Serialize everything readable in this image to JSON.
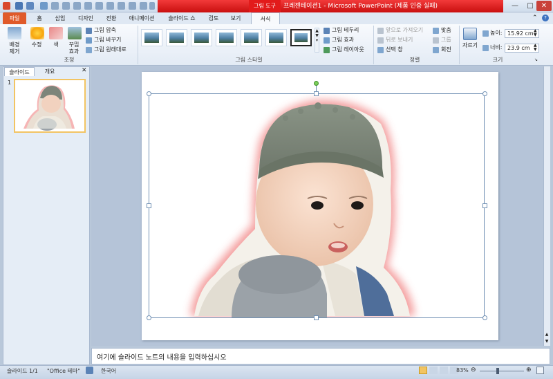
{
  "window": {
    "tool_context": "그림 도구",
    "title": "프레젠테이션1 - Microsoft PowerPoint (제품 인증 실패)",
    "minimize": "—",
    "maximize": "□",
    "close": "✕"
  },
  "tabs": [
    "파일",
    "홈",
    "삽입",
    "디자인",
    "전환",
    "애니메이션",
    "슬라이드 쇼",
    "검토",
    "보기",
    "서식"
  ],
  "ribbon": {
    "adjust": {
      "remove_bg": [
        "배경",
        "제거"
      ],
      "corrections": "수정",
      "color": "색",
      "artistic": [
        "꾸밈",
        "효과"
      ],
      "compress": "그림 압축",
      "change": "그림 바꾸기",
      "reset": "그림 원래대로",
      "label": "조정"
    },
    "styles": {
      "border": "그림 테두리",
      "effects": "그림 효과",
      "layout": "그림 레이아웃",
      "label": "그림 스타일"
    },
    "arrange": {
      "bring_forward": "앞으로 가져오기",
      "send_backward": "뒤로 보내기",
      "selection_pane": "선택 창",
      "align": "맞춤",
      "group": "그룹",
      "rotate": "회전",
      "label": "정렬"
    },
    "size": {
      "crop": "자르기",
      "height_label": "높이:",
      "height_value": "15.92 cm",
      "width_label": "너비:",
      "width_value": "23.9 cm",
      "label": "크기"
    }
  },
  "left_pane": {
    "tab_slides": "슬라이드",
    "tab_outline": "개요",
    "slide_number": "1"
  },
  "notes_placeholder": "여기에 슬라이드 노트의 내용을 입력하십시오",
  "status": {
    "slide_info": "슬라이드 1/1",
    "theme": "\"Office 테마\"",
    "language": "한국어",
    "zoom": "83%"
  },
  "colors": {
    "accent_red": "#e21b1b",
    "file_tab": "#e05a2a",
    "glow": "#f28c8c"
  }
}
